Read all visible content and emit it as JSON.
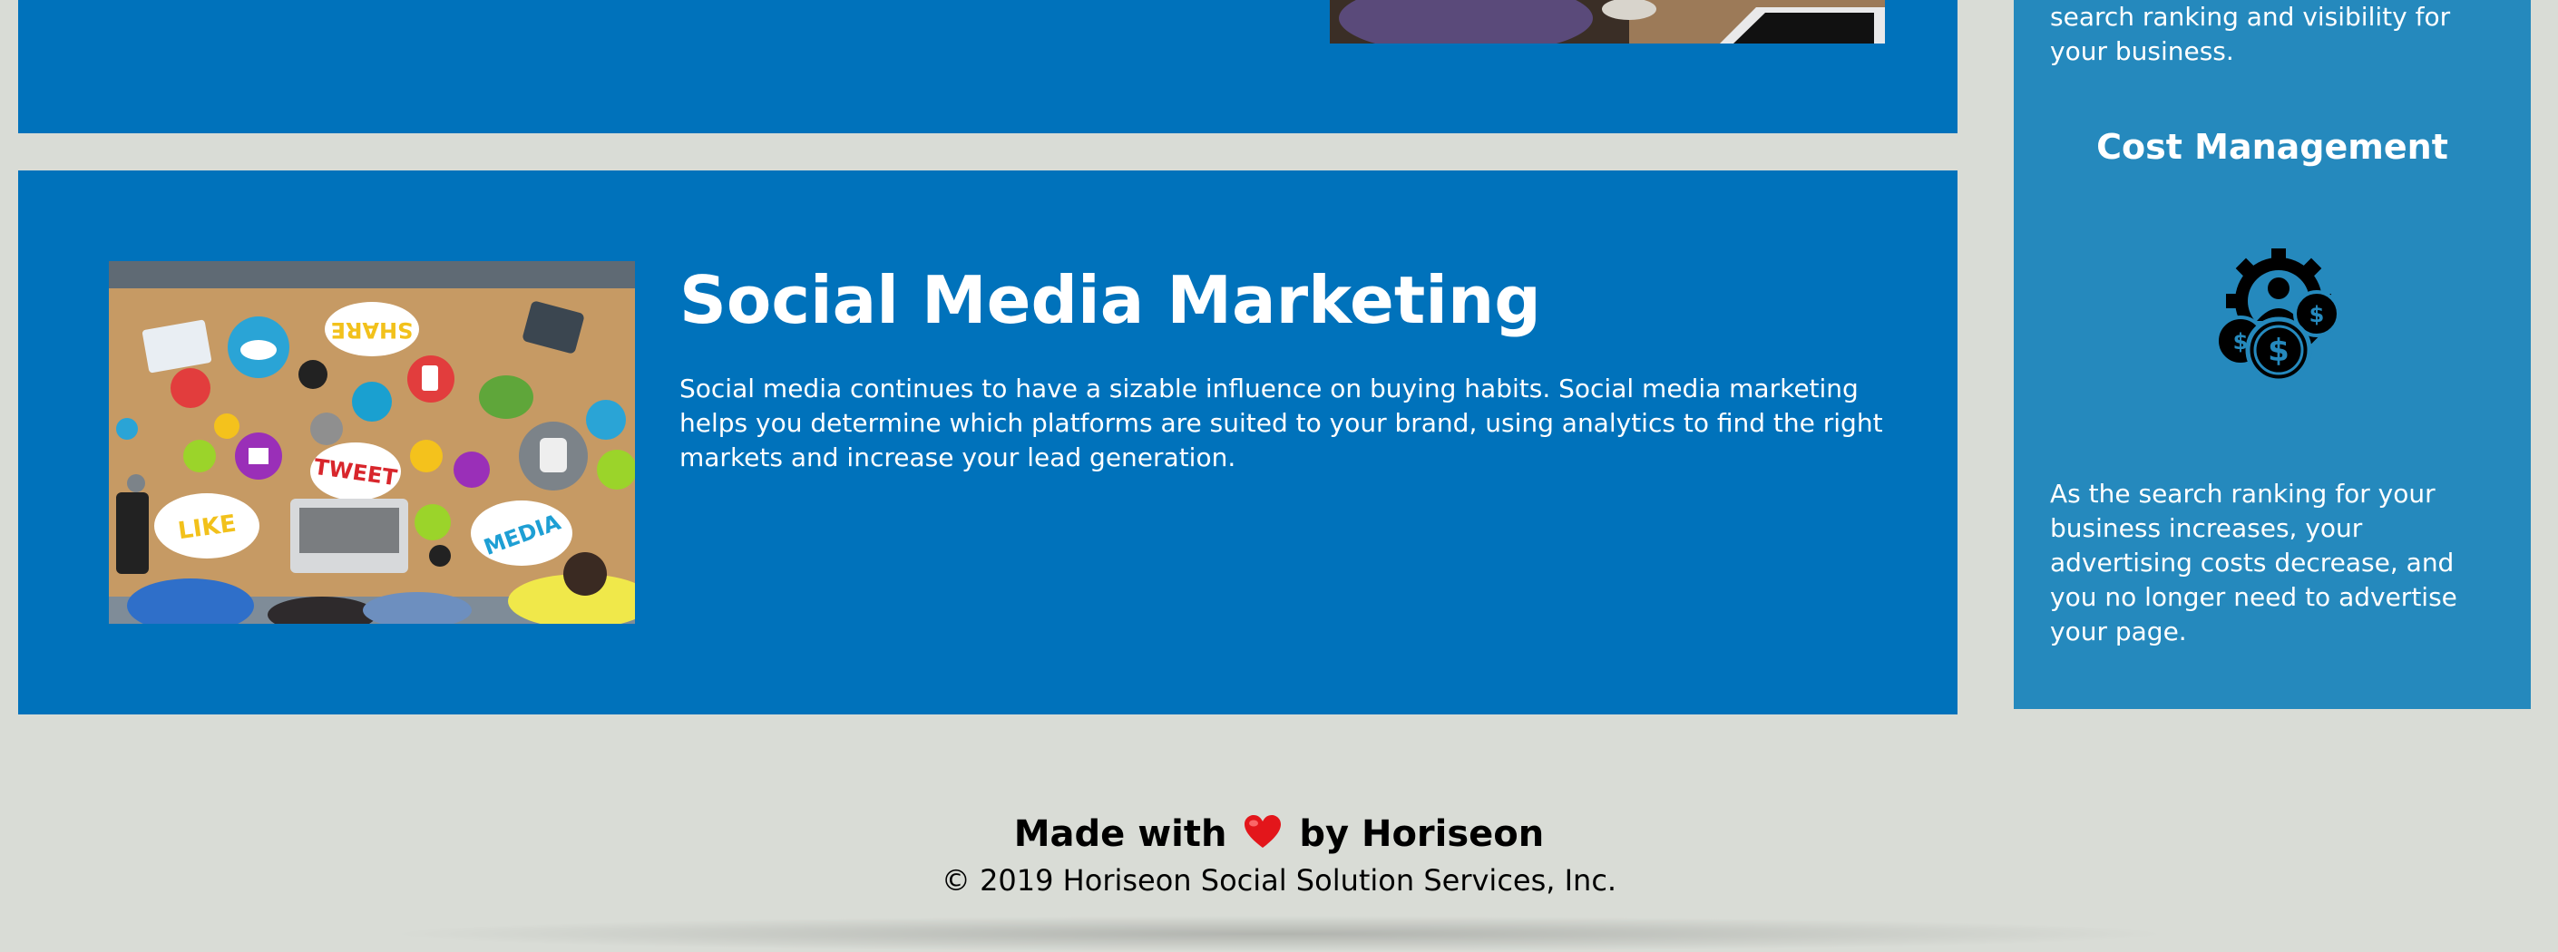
{
  "sidebar": {
    "continued_text": "search ranking and visibility for your business.",
    "cost_title": "Cost Management",
    "cost_icon": "cost-management-icon",
    "cost_text": "As the search ranking for your business increases, your advertising costs decrease, and you no longer need to advertise your page."
  },
  "smm": {
    "title": "Social Media Marketing",
    "text": "Social media continues to have a sizable influence on buying habits. Social media marketing helps you determine which platforms are suited to your brand, using analytics to find the right markets and increase your lead generation.",
    "image_labels": {
      "share": "SHARE",
      "tweet": "TWEET",
      "like": "LIKE",
      "media": "MEDIA"
    }
  },
  "footer": {
    "made_before": "Made with",
    "heart_icon": "heart-icon",
    "made_after": "by Horiseon",
    "copyright": "© 2019 Horiseon Social Solution Services, Inc."
  },
  "colors": {
    "panel": "#0072bb",
    "sidebar": "#2589bd",
    "background": "#d9dcd6"
  }
}
